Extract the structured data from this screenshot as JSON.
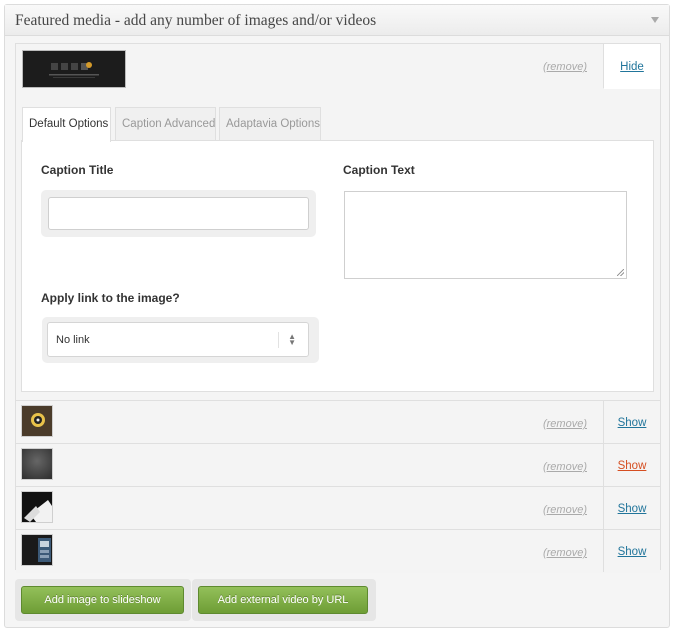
{
  "panel": {
    "title": "Featured media - add any number of images and/or videos"
  },
  "media_items": [
    {
      "remove_label": "(remove)",
      "toggle_label": "Hide",
      "thumbnail": "slideshow-dark-countdown-thumbnail",
      "expanded": true
    },
    {
      "remove_label": "(remove)",
      "toggle_label": "Show",
      "thumbnail": "circular-light-thumbnail"
    },
    {
      "remove_label": "(remove)",
      "toggle_label": "Show",
      "thumbnail": "dark-gradient-thumbnail"
    },
    {
      "remove_label": "(remove)",
      "toggle_label": "Show",
      "thumbnail": "paper-card-thumbnail"
    },
    {
      "remove_label": "(remove)",
      "toggle_label": "Show",
      "thumbnail": "screen-photo-thumbnail"
    }
  ],
  "tabs": [
    {
      "label": "Default Options",
      "active": true
    },
    {
      "label": "Caption Advanced",
      "active": false
    },
    {
      "label": "Adaptavia Options",
      "active": false
    }
  ],
  "form": {
    "caption_title_label": "Caption Title",
    "caption_title_value": "",
    "caption_text_label": "Caption Text",
    "caption_text_value": "",
    "link_label": "Apply link to the image?",
    "link_selected": "No link"
  },
  "buttons": {
    "add_image": "Add image to slideshow",
    "add_video": "Add external video by URL"
  },
  "colors": {
    "link": "#21759b",
    "link_hover": "#d54e21",
    "button_green": "#7aa842"
  }
}
